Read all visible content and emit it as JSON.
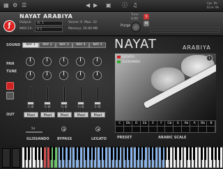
{
  "toolbar": {
    "icons": [
      "instrument-icon",
      "tools-icon",
      "menu-icon",
      "prev-icon",
      "next-icon",
      "camera-icon",
      "info-icon",
      "midi-icon"
    ],
    "cpu_label": "Cpu",
    "cpu_value": "0%",
    "disk_label": "Disk",
    "disk_value": "0%"
  },
  "header": {
    "instrument_name": "NAYAT ARABIYA",
    "output_label": "Output:",
    "output_value": "st. 1",
    "midi_label": "MIDI Ch:",
    "midi_value": "A 1",
    "voices_label": "Voices:",
    "voices_value": "0",
    "voices_max_label": "Max:",
    "voices_max_value": "32",
    "memory_label": "Memory:",
    "memory_value": "20.89 MB",
    "purge_label": "Purge",
    "tune_label": "Tune",
    "tune_value": "0.00",
    "solo_label": "S",
    "mute_label": "M"
  },
  "panel": {
    "title": "NAYAT",
    "subtitle": "ARABIYA",
    "sound_label": "SOUND",
    "pan_label": "PAN",
    "tune_label": "TUNE",
    "out_label": "OUT",
    "tabs": [
      "NAY 1",
      "NAY 2",
      "NAY 3",
      "NAY 4",
      "NAY 5"
    ],
    "active_tab": 0,
    "fader_values": [
      "0 dB",
      "0 dB",
      "0 dB",
      "0 dB",
      "0 dB"
    ],
    "out_buttons": [
      "Mast",
      "Mast",
      "Mast",
      "Mast",
      "Mast"
    ],
    "legend": [
      {
        "label": "LEGATO",
        "color": "#c22"
      },
      {
        "label": "GLISSANDO",
        "color": "#3a3"
      }
    ],
    "info_symbol": "i",
    "scale_notes": [
      "C",
      "Db",
      "D",
      "Eb",
      "E",
      "F",
      "Gb",
      "G",
      "Ab",
      "A",
      "Bb",
      "B"
    ],
    "preset_label": "PRESET",
    "arabic_scale_label": "ARABIC SCALE",
    "glissando_label": "GLISSANDO",
    "glissando_value": "5d",
    "bypass_label": "BYPASS",
    "legato_label": "LEGATO"
  },
  "colors": {
    "accent_red": "#cc2222",
    "accent_green": "#33aa33",
    "key_highlight_blue": "#8ab4e8",
    "key_highlight_green": "#6fc46f",
    "key_highlight_red": "#d05050"
  },
  "meters": {
    "left_level": 0,
    "right_level": 0
  }
}
